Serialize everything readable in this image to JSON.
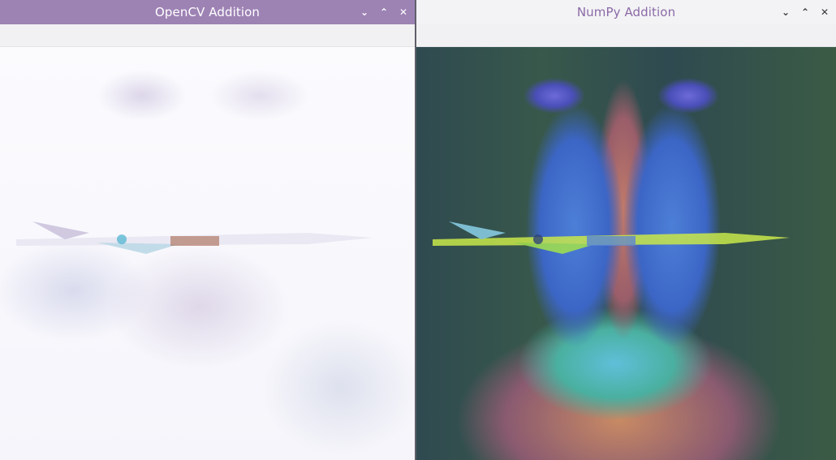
{
  "windows": [
    {
      "title": "OpenCV Addition",
      "controls": {
        "minimize": "⌄",
        "maximize": "⌃",
        "close": "✕"
      }
    },
    {
      "title": "NumPy Addition",
      "controls": {
        "minimize": "⌄",
        "maximize": "⌃",
        "close": "✕"
      }
    }
  ],
  "icons": {
    "minimize": "chevron-down-icon",
    "maximize": "chevron-up-icon",
    "close": "close-icon"
  },
  "colors": {
    "left_titlebar": "#9d82b4",
    "right_titlebar": "#f3f3f5",
    "right_title_text": "#8b6aa7"
  }
}
